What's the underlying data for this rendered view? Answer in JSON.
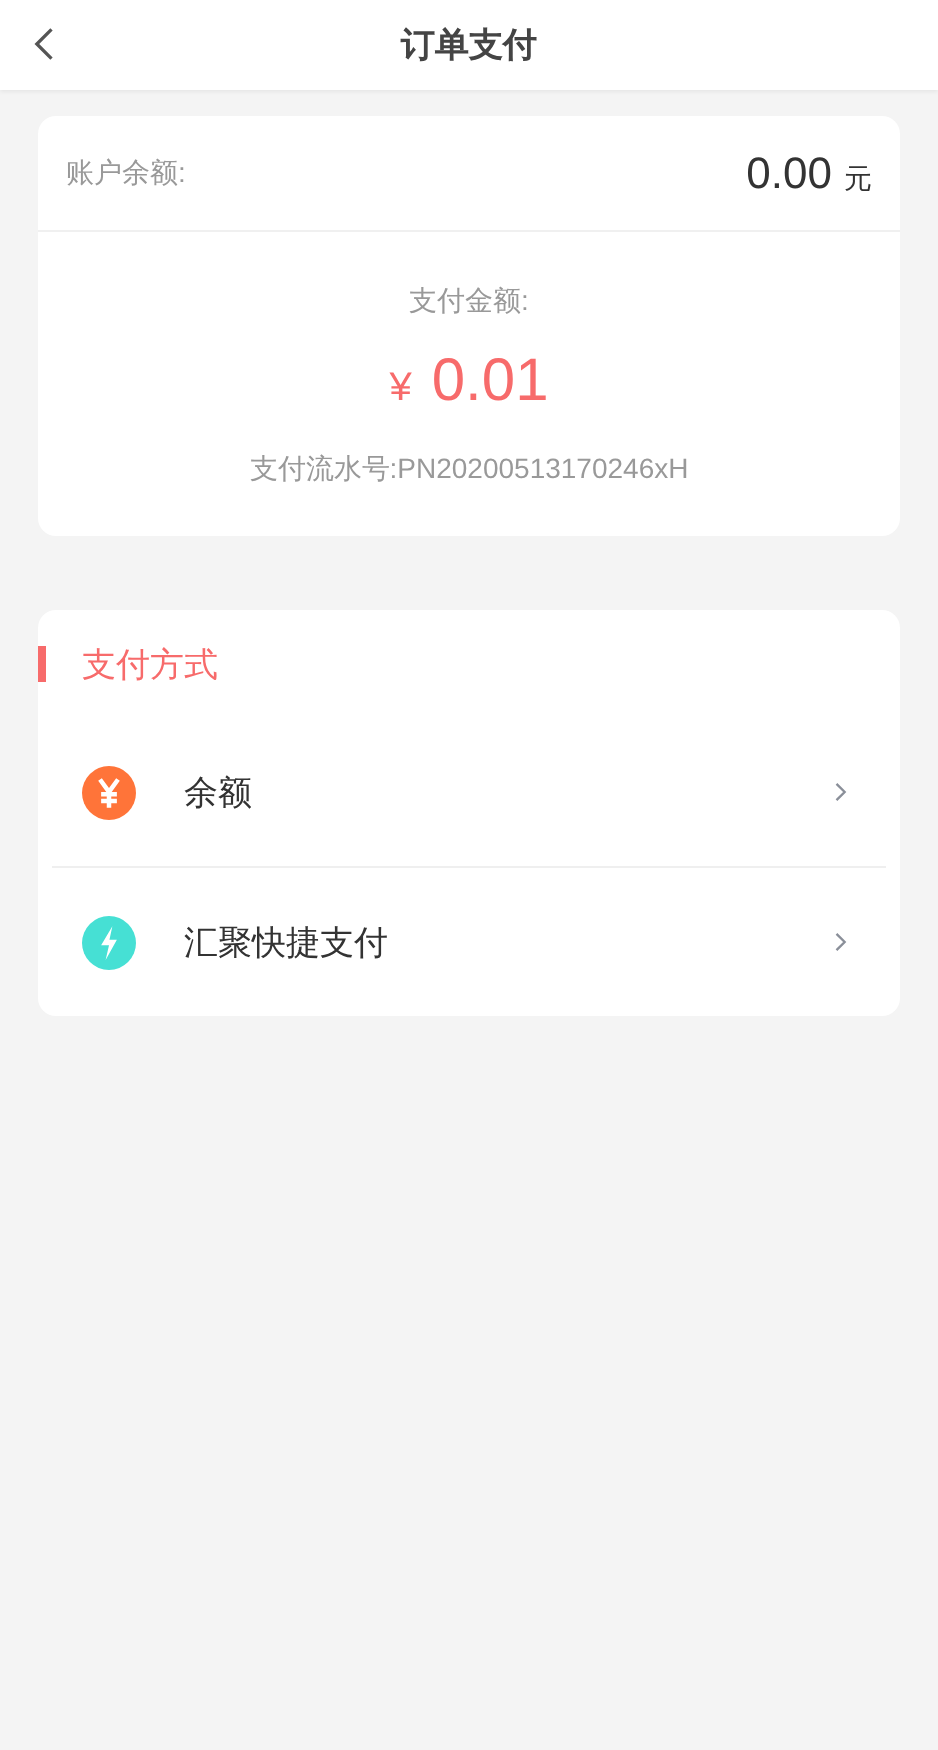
{
  "header": {
    "title": "订单支付"
  },
  "summary": {
    "balance_label": "账户余额:",
    "balance_value": "0.00",
    "balance_unit": "元",
    "amount_label": "支付金额:",
    "currency": "¥",
    "amount": "0.01",
    "serial": "支付流水号:PN20200513170246xH"
  },
  "methods_section": {
    "title": "支付方式",
    "items": [
      {
        "label": "余额",
        "kind": "yen",
        "color": "#ff7439"
      },
      {
        "label": "汇聚快捷支付",
        "kind": "bolt",
        "color": "#46e0d4"
      }
    ]
  }
}
